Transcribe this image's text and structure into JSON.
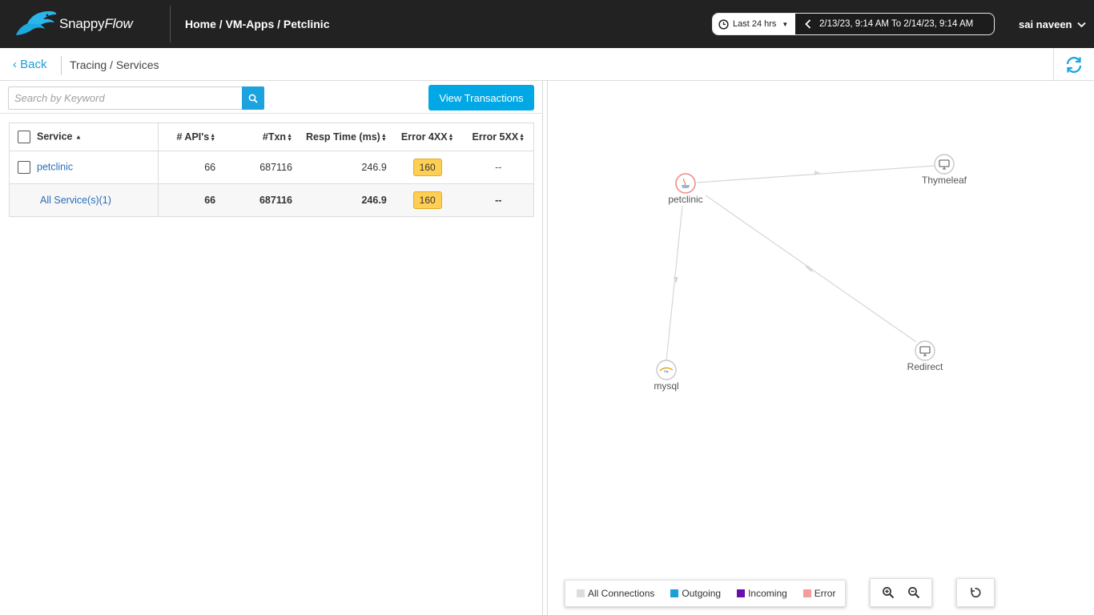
{
  "header": {
    "logo_text_a": "Snappy",
    "logo_text_b": "Flow",
    "breadcrumb": "Home / VM-Apps / Petclinic",
    "time_preset": "Last 24 hrs",
    "time_range": "2/13/23, 9:14 AM To 2/14/23, 9:14 AM",
    "user": "sai naveen"
  },
  "subheader": {
    "back": "Back",
    "breadcrumb": "Tracing / Services"
  },
  "toolbar": {
    "search_placeholder": "Search by Keyword",
    "view_transactions": "View Transactions"
  },
  "table": {
    "headers": {
      "service": "Service",
      "apis": "# API's",
      "txn": "#Txn",
      "resp": "Resp Time (ms)",
      "e4xx": "Error 4XX",
      "e5xx": "Error 5XX"
    },
    "rows": [
      {
        "service": "petclinic",
        "apis": "66",
        "txn": "687116",
        "resp": "246.9",
        "e4xx": "160",
        "e5xx": "--"
      }
    ],
    "total": {
      "service": "All Service(s)(1)",
      "apis": "66",
      "txn": "687116",
      "resp": "246.9",
      "e4xx": "160",
      "e5xx": "--"
    }
  },
  "graph": {
    "nodes": {
      "petclinic": "petclinic",
      "thymeleaf": "Thymeleaf",
      "mysql": "mysql",
      "redirect": "Redirect"
    },
    "node_icons": {
      "petclinic": "java-icon",
      "thymeleaf": "monitor-icon",
      "mysql": "mysql-icon",
      "redirect": "monitor-icon"
    }
  },
  "legend": {
    "all": "All Connections",
    "outgoing": "Outgoing",
    "incoming": "Incoming",
    "error": "Error"
  },
  "colors": {
    "header_bg": "#222222",
    "accent": "#00a8e6",
    "badge": "#ffcf54",
    "legend_all": "#dddddd",
    "legend_outgoing": "#1a9fd6",
    "legend_incoming": "#6a0dad",
    "legend_error": "#f29c9c"
  }
}
